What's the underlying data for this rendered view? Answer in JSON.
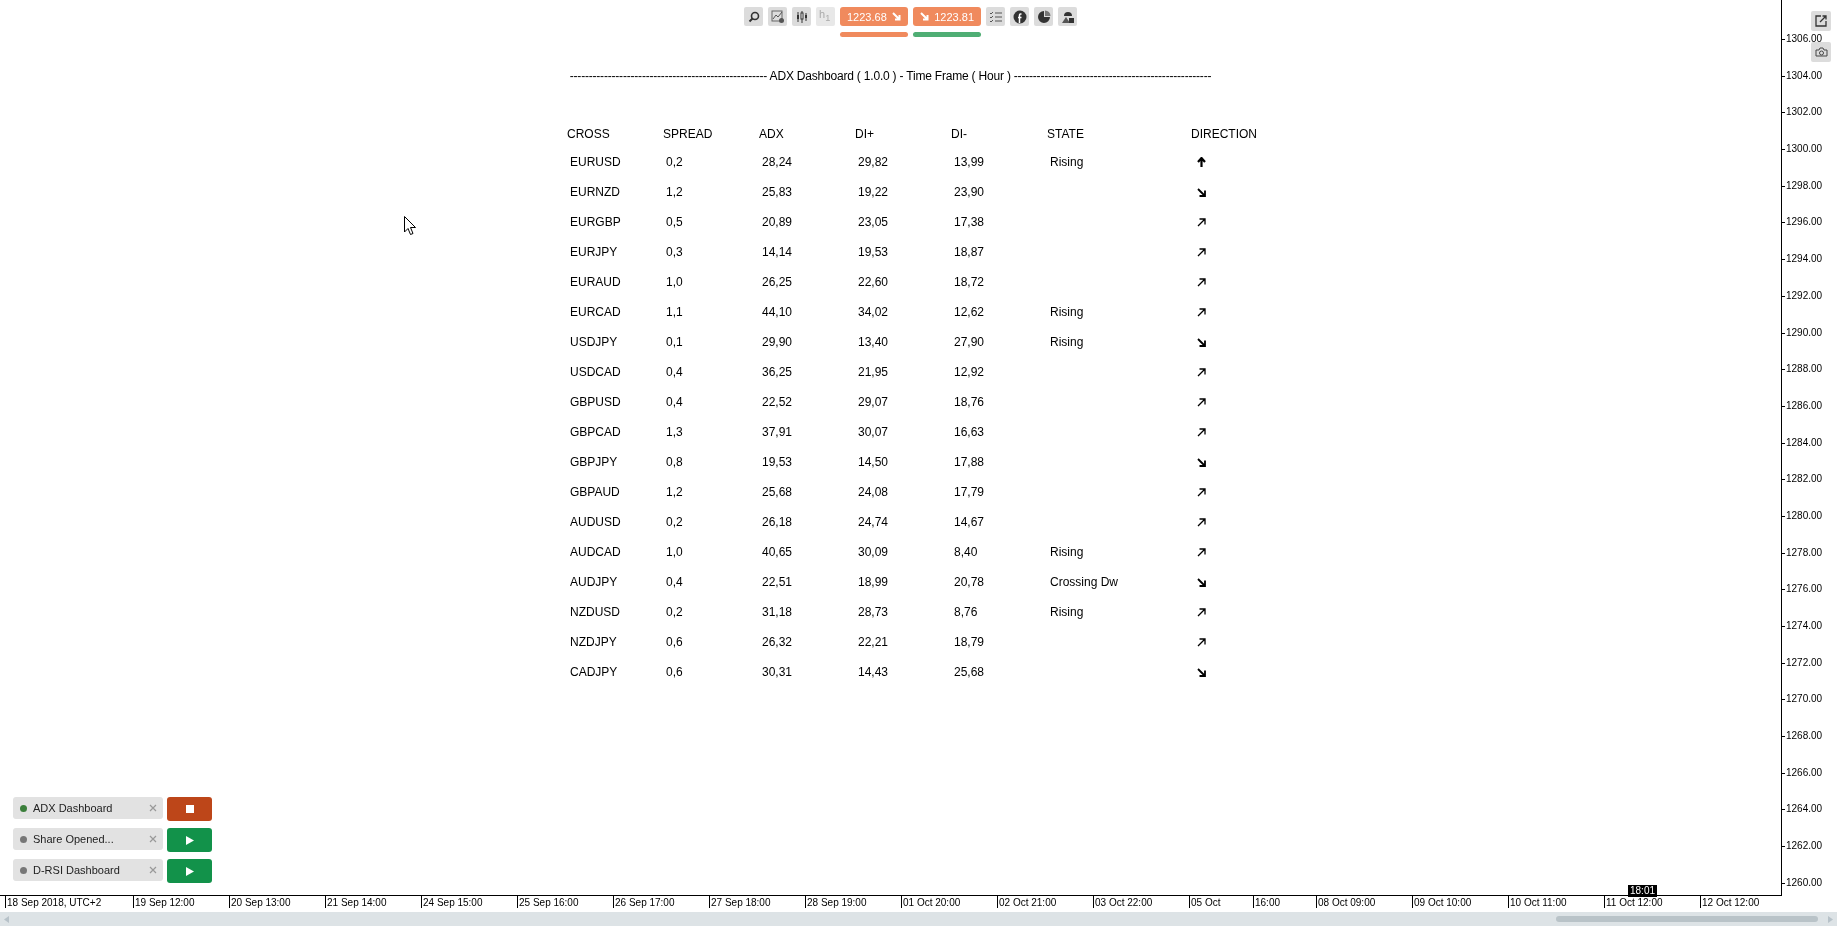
{
  "toolbar": {
    "timeframe": "h$_{1}$",
    "sell": {
      "price": "1223.68"
    },
    "buy": {
      "price": "1223.81"
    }
  },
  "dashboard": {
    "title": "---------------------------------------------------- ADX Dashboard ( 1.0.0 ) - Time Frame ( Hour ) ----------------------------------------------------",
    "columns": [
      "CROSS",
      "SPREAD",
      "ADX",
      "DI+",
      "DI-",
      "STATE",
      "DIRECTION"
    ],
    "rows": [
      {
        "cross": "EURUSD",
        "spread": "0,2",
        "adx": "28,24",
        "di_plus": "29,82",
        "di_minus": "13,99",
        "state": "Rising",
        "kind": "up"
      },
      {
        "cross": "EURNZD",
        "spread": "1,2",
        "adx": "25,83",
        "di_plus": "19,22",
        "di_minus": "23,90",
        "kind": "down_right"
      },
      {
        "cross": "EURGBP",
        "spread": "0,5",
        "adx": "20,89",
        "di_plus": "23,05",
        "di_minus": "17,38",
        "kind": "up_right"
      },
      {
        "cross": "EURJPY",
        "spread": "0,3",
        "adx": "14,14",
        "di_plus": "19,53",
        "di_minus": "18,87",
        "kind": "up_right"
      },
      {
        "cross": "EURAUD",
        "spread": "1,0",
        "adx": "26,25",
        "di_plus": "22,60",
        "di_minus": "18,72",
        "kind": "up_right"
      },
      {
        "cross": "EURCAD",
        "spread": "1,1",
        "adx": "44,10",
        "di_plus": "34,02",
        "di_minus": "12,62",
        "state": "Rising",
        "kind": "up_right"
      },
      {
        "cross": "USDJPY",
        "spread": "0,1",
        "adx": "29,90",
        "di_plus": "13,40",
        "di_minus": "27,90",
        "state": "Rising",
        "kind": "down_right"
      },
      {
        "cross": "USDCAD",
        "spread": "0,4",
        "adx": "36,25",
        "di_plus": "21,95",
        "di_minus": "12,92",
        "kind": "up_right"
      },
      {
        "cross": "GBPUSD",
        "spread": "0,4",
        "adx": "22,52",
        "di_plus": "29,07",
        "di_minus": "18,76",
        "kind": "up_right"
      },
      {
        "cross": "GBPCAD",
        "spread": "1,3",
        "adx": "37,91",
        "di_plus": "30,07",
        "di_minus": "16,63",
        "kind": "up_right"
      },
      {
        "cross": "GBPJPY",
        "spread": "0,8",
        "adx": "19,53",
        "di_plus": "14,50",
        "di_minus": "17,88",
        "kind": "down_right"
      },
      {
        "cross": "GBPAUD",
        "spread": "1,2",
        "adx": "25,68",
        "di_plus": "24,08",
        "di_minus": "17,79",
        "kind": "up_right"
      },
      {
        "cross": "AUDUSD",
        "spread": "0,2",
        "adx": "26,18",
        "di_plus": "24,74",
        "di_minus": "14,67",
        "kind": "up_right"
      },
      {
        "cross": "AUDCAD",
        "spread": "1,0",
        "adx": "40,65",
        "di_plus": "30,09",
        "di_minus": "8,40",
        "state": "Rising",
        "kind": "up_right"
      },
      {
        "cross": "AUDJPY",
        "spread": "0,4",
        "adx": "22,51",
        "di_plus": "18,99",
        "di_minus": "20,78",
        "state": "Crossing Dw",
        "kind": "down_right"
      },
      {
        "cross": "NZDUSD",
        "spread": "0,2",
        "adx": "31,18",
        "di_plus": "28,73",
        "di_minus": "8,76",
        "state": "Rising",
        "kind": "up_right"
      },
      {
        "cross": "NZDJPY",
        "spread": "0,6",
        "adx": "26,32",
        "di_plus": "22,21",
        "di_minus": "18,79",
        "kind": "up_right"
      },
      {
        "cross": "CADJPY",
        "spread": "0,6",
        "adx": "30,31",
        "di_plus": "14,43",
        "di_minus": "25,68",
        "kind": "down_right"
      }
    ]
  },
  "bots": [
    {
      "name": "ADX Dashboard",
      "running": true
    },
    {
      "name": "Share Opened...",
      "running": false
    },
    {
      "name": "D-RSI Dashboard",
      "running": false
    }
  ],
  "price_axis": [
    "1306.00",
    "1304.00",
    "1302.00",
    "1300.00",
    "1298.00",
    "1296.00",
    "1294.00",
    "1292.00",
    "1290.00",
    "1288.00",
    "1286.00",
    "1284.00",
    "1282.00",
    "1280.00",
    "1278.00",
    "1276.00",
    "1274.00",
    "1272.00",
    "1270.00",
    "1268.00",
    "1266.00",
    "1264.00",
    "1262.00",
    "1260.00"
  ],
  "time_axis": [
    "18 Sep 2018, UTC+2",
    "19 Sep 12:00",
    "20 Sep 13:00",
    "21 Sep 14:00",
    "24 Sep 15:00",
    "25 Sep 16:00",
    "26 Sep 17:00",
    "27 Sep 18:00",
    "28 Sep 19:00",
    "01 Oct 20:00",
    "02 Oct 21:00",
    "03 Oct 22:00",
    "05 Oct",
    "16:00",
    "08 Oct 09:00",
    "09 Oct 10:00",
    "10 Oct 11:00",
    "11 Oct 12:00",
    "12 Oct 12:00"
  ],
  "crosshair_time": "18:01"
}
